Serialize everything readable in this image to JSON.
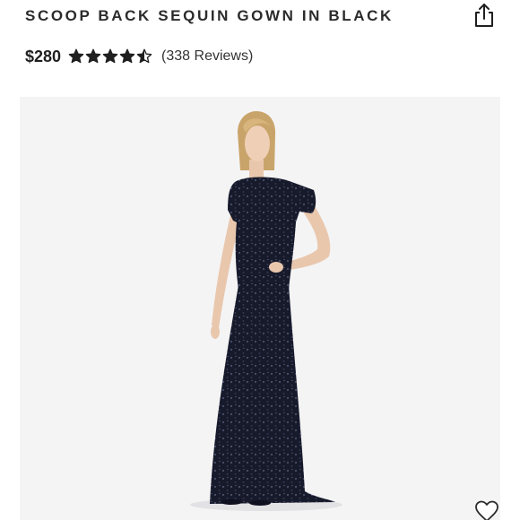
{
  "product": {
    "title": "SCOOP BACK SEQUIN GOWN IN BLACK",
    "price": "$280",
    "rating": 4.5,
    "rating_max": 5,
    "reviews_text": "(338 Reviews)"
  },
  "icons": {
    "share": "share-icon",
    "favorite": "heart-outline-icon",
    "star": "star-icon"
  },
  "colors": {
    "text": "#1f1f1f",
    "star": "#1f1f1f",
    "image_background": "#f4f4f5",
    "gown": "#171a2b"
  }
}
